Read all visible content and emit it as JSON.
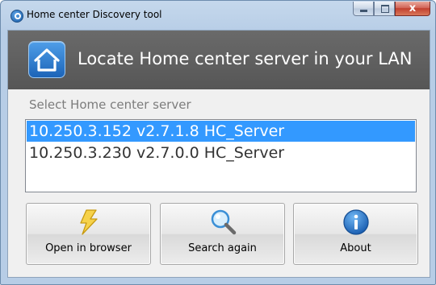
{
  "window": {
    "title": "Home center Discovery tool",
    "controls": {
      "close_glyph": "x"
    }
  },
  "header": {
    "title": "Locate Home center server in your LAN",
    "logo_icon": "home-icon",
    "background": "#5e5e5e"
  },
  "server_select": {
    "label": "Select Home center server",
    "selected_index": 0,
    "items": [
      "10.250.3.152 v2.7.1.8 HC_Server",
      "10.250.3.230 v2.7.0.0 HC_Server"
    ]
  },
  "buttons": {
    "open_browser": {
      "label": "Open in browser",
      "icon": "lightning-icon"
    },
    "search_again": {
      "label": "Search again",
      "icon": "magnifier-icon"
    },
    "about": {
      "label": "About",
      "icon": "info-icon"
    }
  },
  "colors": {
    "selection": "#3399ff",
    "accent_blue": "#1c64b8"
  }
}
